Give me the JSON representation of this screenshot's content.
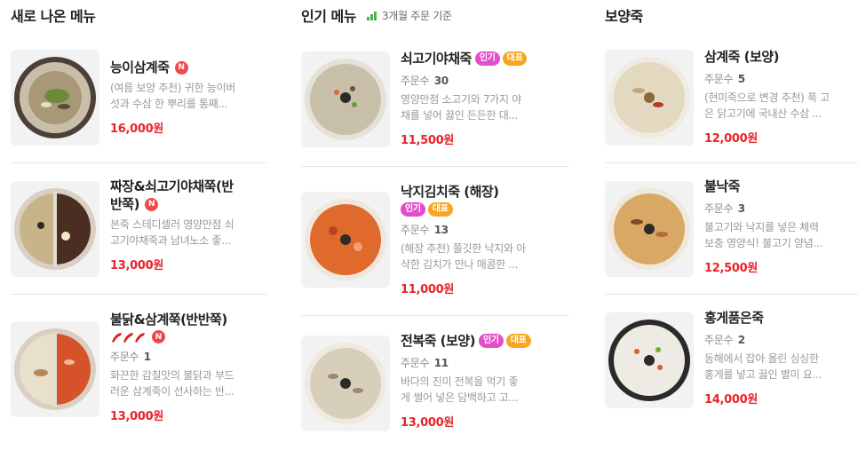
{
  "columns": [
    {
      "title": "새로 나온 메뉴",
      "items": [
        {
          "name": "능이삼계죽",
          "new_badge": "N",
          "desc": [
            "(여름 보양 추천) 귀한 능이버",
            "섯과 수삼 한 뿌리를 통째..."
          ],
          "price": "16,000원"
        },
        {
          "name_lines": [
            "짜장&쇠고기야채쭉(반",
            "반쭉)"
          ],
          "new_badge": "N",
          "desc": [
            "본죽 스테디셀러 영양만점 쇠",
            "고기야채죽과 남녀노소 좋..."
          ],
          "price": "13,000원"
        },
        {
          "name": "불닭&삼계쭉(반반쭉)",
          "new_badge": "N",
          "spicy": "pepper-icon",
          "order_label": "주문수",
          "order_count": "1",
          "desc": [
            "화끈한 감칠맛의 불닭과 부드",
            "러운 삼계죽이 선사하는 반..."
          ],
          "price": "13,000원"
        }
      ]
    },
    {
      "title": "인기 메뉴",
      "basis": "3개월 주문 기준",
      "items": [
        {
          "name": "쇠고기야채죽",
          "tags": [
            "인기",
            "대표"
          ],
          "order_label": "주문수",
          "order_count": "30",
          "desc": [
            "영양만점 소고기와 7가지 야",
            "채를 넣어 끓인 든든한 대..."
          ],
          "price": "11,500원"
        },
        {
          "name": "낙지김치죽 (해장)",
          "tags": [
            "인기",
            "대표"
          ],
          "order_label": "주문수",
          "order_count": "13",
          "desc": [
            "(해장 추천) 쫄깃한 낙지와 아",
            "삭한 김치가 만나 매콤한 ..."
          ],
          "price": "11,000원"
        },
        {
          "name": "전복죽 (보양)",
          "tags": [
            "인기",
            "대표"
          ],
          "order_label": "주문수",
          "order_count": "11",
          "desc": [
            "바다의 진미 전복을 먹기 좋",
            "게 썰어 넣은 담백하고 고..."
          ],
          "price": "13,000원"
        }
      ]
    },
    {
      "title": "보양죽",
      "items": [
        {
          "name": "삼계죽 (보양)",
          "order_label": "주문수",
          "order_count": "5",
          "desc": [
            "(현미죽으로 변경 추천) 푹 고",
            "은 닭고기에 국내산 수삼 ..."
          ],
          "price": "12,000원"
        },
        {
          "name": "불낙죽",
          "order_label": "주문수",
          "order_count": "3",
          "desc": [
            "불고기와 낙지를 넣은 체력",
            "보충 영양식! 불고기 양념..."
          ],
          "price": "12,500원"
        },
        {
          "name": "홍게품은죽",
          "order_label": "주문수",
          "order_count": "2",
          "desc": [
            "동해에서 잡아 올린 싱싱한",
            "홍게를 넣고 끓인 별미 요..."
          ],
          "price": "14,000원"
        }
      ]
    }
  ],
  "colors": {
    "price": "#e8232a",
    "new_badge": "#f04848",
    "tag_popular": "#e44ec9",
    "tag_signature": "#f5a623",
    "basis_icon": "#4caf50"
  },
  "icons": {
    "basis": "bar-chart-icon",
    "spicy": "pepper-icon",
    "new": "new-badge"
  }
}
